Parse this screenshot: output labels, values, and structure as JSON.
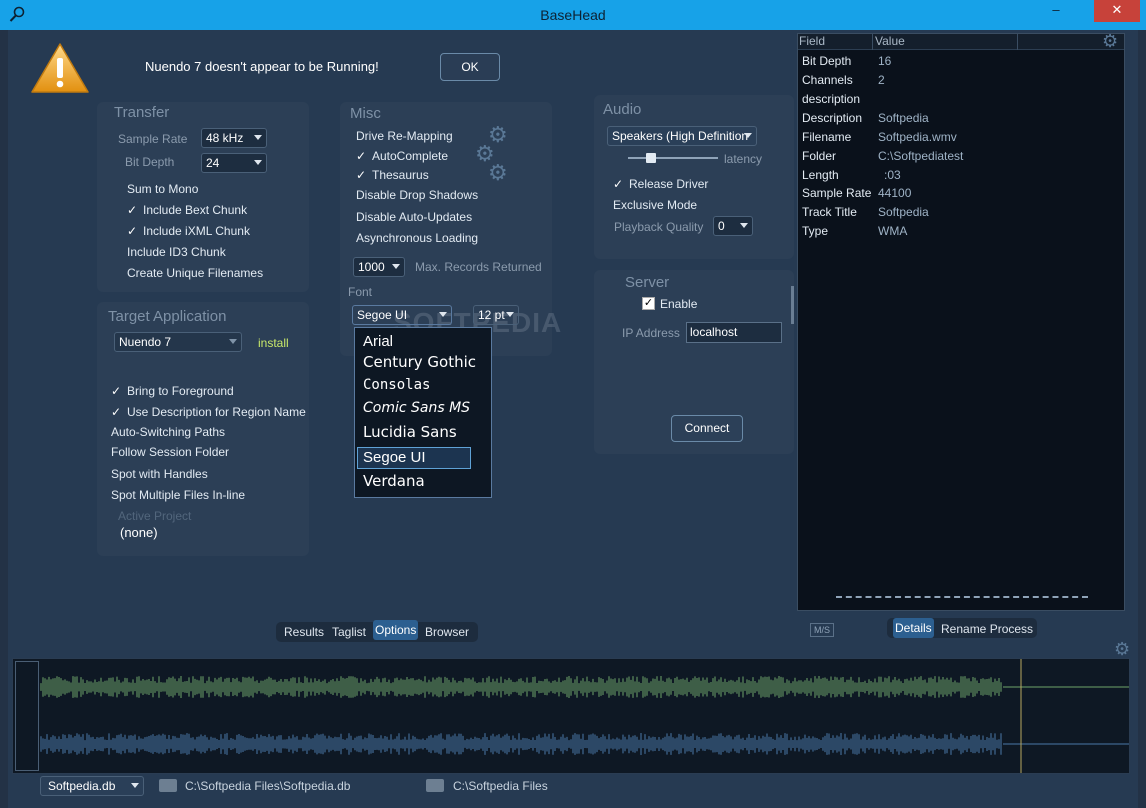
{
  "window": {
    "title": "BaseHead",
    "minimize": "‒",
    "close": "✕",
    "search_icon": "magnifier-icon"
  },
  "alert": {
    "message": "Nuendo 7 doesn't appear to be Running!",
    "ok_label": "OK"
  },
  "transfer": {
    "title": "Transfer",
    "sample_rate_label": "Sample Rate",
    "sample_rate_value": "48 kHz",
    "bit_depth_label": "Bit Depth",
    "bit_depth_value": "24",
    "options": [
      {
        "label": "Sum to Mono",
        "checked": false
      },
      {
        "label": "Include Bext Chunk",
        "checked": true
      },
      {
        "label": "Include iXML Chunk",
        "checked": true
      },
      {
        "label": "Include ID3 Chunk",
        "checked": false
      },
      {
        "label": "Create Unique Filenames",
        "checked": false
      }
    ]
  },
  "misc": {
    "title": "Misc",
    "options": [
      {
        "label": "Drive Re-Mapping",
        "checked": false
      },
      {
        "label": "AutoComplete",
        "checked": true
      },
      {
        "label": "Thesaurus",
        "checked": true
      },
      {
        "label": "Disable Drop Shadows",
        "checked": false
      },
      {
        "label": "Disable Auto-Updates",
        "checked": false
      },
      {
        "label": "Asynchronous Loading",
        "checked": false
      }
    ],
    "max_records_value": "1000",
    "max_records_label": "Max. Records Returned",
    "font_label": "Font",
    "font_value": "Segoe UI",
    "font_size_value": "12 pt",
    "font_options": [
      "Arial",
      "Century Gothic",
      "Consolas",
      "Comic Sans MS",
      "Lucidia Sans",
      "Segoe UI",
      "Verdana"
    ],
    "font_selected": "Segoe UI"
  },
  "audio": {
    "title": "Audio",
    "device_value": "Speakers (High Definition",
    "latency_label": "latency",
    "release_driver": "Release Driver",
    "exclusive_mode": "Exclusive Mode",
    "playback_quality_label": "Playback Quality",
    "playback_quality_value": "0"
  },
  "server": {
    "title": "Server",
    "enable_label": "Enable",
    "ip_label": "IP Address",
    "ip_value": "localhost",
    "connect_label": "Connect"
  },
  "target": {
    "title": "Target Application",
    "app_value": "Nuendo 7",
    "install_label": "install",
    "options": [
      {
        "label": "Bring to Foreground",
        "checked": true
      },
      {
        "label": "Use Description for Region Name",
        "checked": true
      },
      {
        "label": "Auto-Switching Paths",
        "checked": false
      },
      {
        "label": "Follow Session Folder",
        "checked": false
      },
      {
        "label": "Spot with Handles",
        "checked": false
      },
      {
        "label": "Spot Multiple Files In-line",
        "checked": false
      }
    ],
    "active_project_label": "Active Project",
    "active_project_value": "(none)"
  },
  "details": {
    "col_field": "Field",
    "col_value": "Value",
    "rows": [
      {
        "field": "Bit Depth",
        "value": "16"
      },
      {
        "field": "Channels",
        "value": "2"
      },
      {
        "field": "description",
        "value": ""
      },
      {
        "field": "Description",
        "value": "Softpedia"
      },
      {
        "field": "Filename",
        "value": "Softpedia.wmv"
      },
      {
        "field": "Folder",
        "value": "C:\\Softpediatest"
      },
      {
        "field": "Length",
        "value": ":03"
      },
      {
        "field": "Sample Rate",
        "value": "44100"
      },
      {
        "field": "Track Title",
        "value": "Softpedia"
      },
      {
        "field": "Type",
        "value": "WMA"
      }
    ],
    "ms_label": "M/S",
    "tabs": [
      "Details",
      "Rename Process"
    ]
  },
  "left_tabs": [
    "Results",
    "Taglist",
    "Options",
    "Browser"
  ],
  "active_left_tab": "Options",
  "bottom": {
    "db_value": "Softpedia.db",
    "db_path": "C:\\Softpedia Files\\Softpedia.db",
    "folder_path": "C:\\Softpedia Files"
  },
  "watermark": "SOFTPEDIA",
  "colors": {
    "titlebar": "#17a2e8",
    "background": "#263a52",
    "wave_top": "#6fa36a",
    "wave_bottom": "#4a78a8",
    "install": "#c8e86a"
  }
}
